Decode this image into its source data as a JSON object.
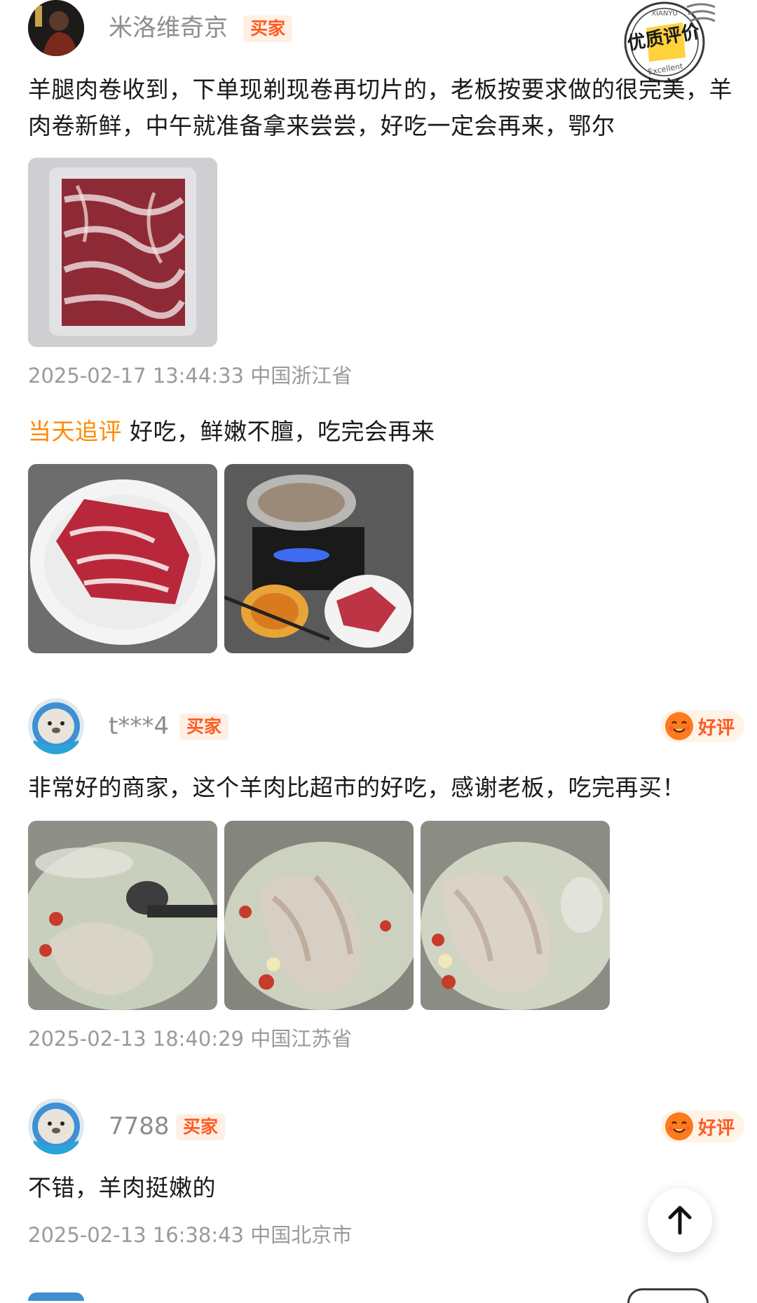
{
  "reviews": [
    {
      "username": "米洛维奇京",
      "buyer_tag": "买家",
      "badge": "优质评价",
      "text": "羊腿肉卷收到，下单现剃现卷再切片的，老板按要求做的很完美，羊肉卷新鲜，中午就准备拿来尝尝，好吃一定会再来，鄂尔",
      "date": "2025-02-17 13:44:33",
      "location": "中国浙江省",
      "followup_label": "当天追评",
      "followup_text": "好吃，鲜嫩不膻，吃完会再来"
    },
    {
      "username": "t***4",
      "buyer_tag": "买家",
      "rating": "好评",
      "text": "非常好的商家，这个羊肉比超市的好吃，感谢老板，吃完再买！",
      "date": "2025-02-13 18:40:29",
      "location": "中国江苏省"
    },
    {
      "username": "7788",
      "buyer_tag": "买家",
      "rating": "好评",
      "text": "不错，羊肉挺嫩的",
      "date": "2025-02-13 16:38:43",
      "location": "中国北京市"
    }
  ],
  "scroll_top_icon": "arrow-up-icon",
  "colors": {
    "accent": "#ff5a1f",
    "followup": "#ff8a00",
    "meta": "#9a9a9a"
  }
}
